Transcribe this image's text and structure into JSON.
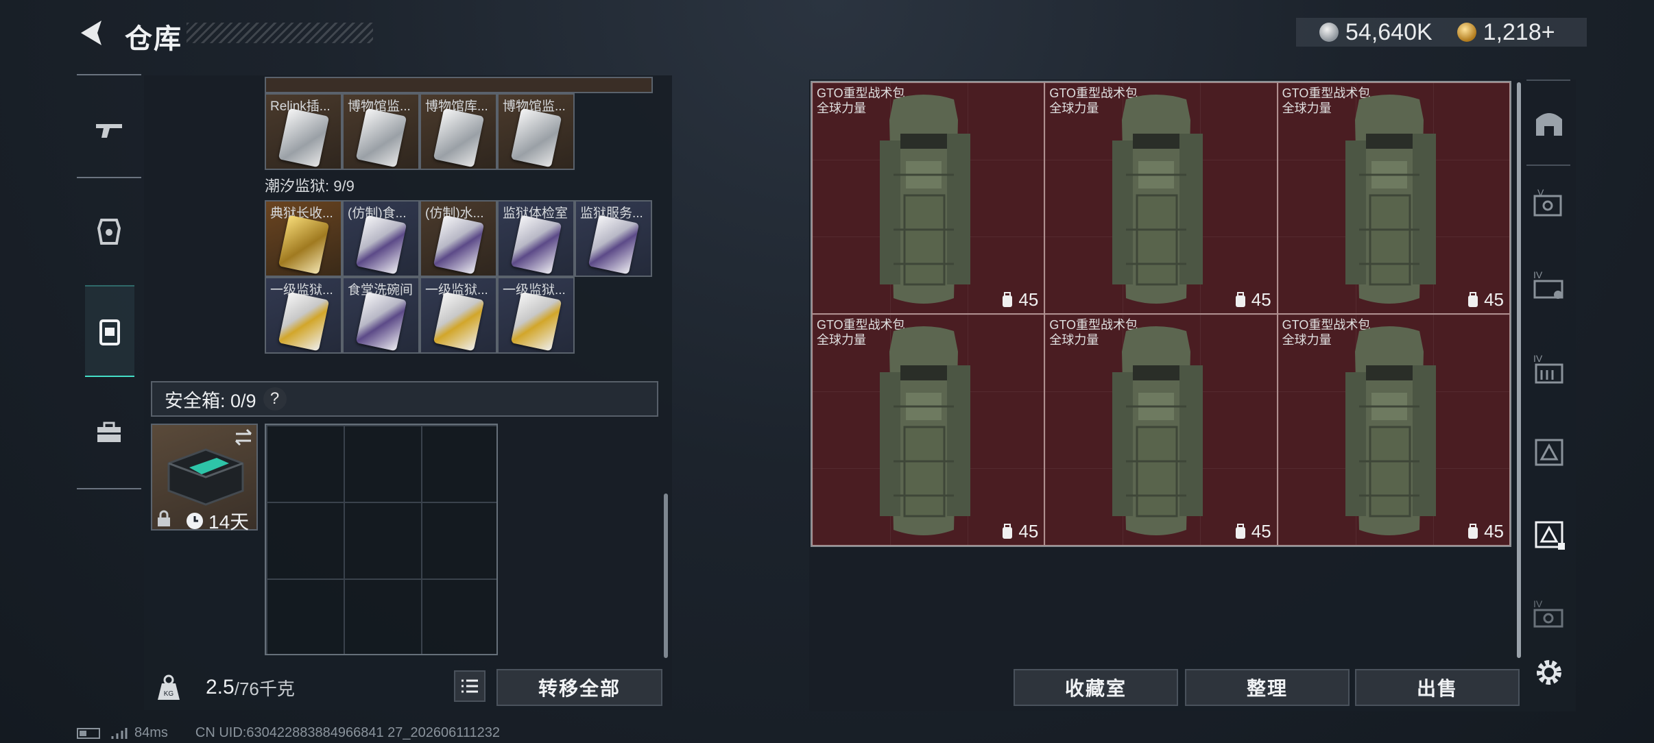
{
  "header": {
    "title": "仓库"
  },
  "currency": {
    "silver": "54,640K",
    "gold": "1,218+"
  },
  "sidebar": {
    "items": [
      "gun-icon",
      "helmet-icon",
      "backpack-icon",
      "toolbox-icon"
    ]
  },
  "left": {
    "row1_labels": [
      "Relink插...",
      "博物馆监...",
      "博物馆库...",
      "博物馆监..."
    ],
    "section_title": "潮汐监狱: 9/9",
    "row2_labels": [
      "典狱长收...",
      "(仿制)食...",
      "(仿制)水...",
      "监狱体检室",
      "监狱服务..."
    ],
    "row3_labels": [
      "一级监狱...",
      "食堂洗碗间",
      "一级监狱...",
      "一级监狱..."
    ],
    "safebox_label": "安全箱: 0/9",
    "safebox_help": "?",
    "case_timer": "14天",
    "weight": "2.5",
    "weight_total": "/76千克",
    "transfer_all": "转移全部"
  },
  "right": {
    "item_name": "GTO重型战术包",
    "item_sub": "全球力量",
    "level": "45",
    "buttons": {
      "collection": "收藏室",
      "organize": "整理",
      "sell": "出售"
    }
  },
  "status": {
    "ping": "84ms",
    "uid": "CN UID:630422883884966841 27_202606111232"
  },
  "colors": {
    "accent": "#45e0c8",
    "item_bg": "#4a1d22"
  }
}
